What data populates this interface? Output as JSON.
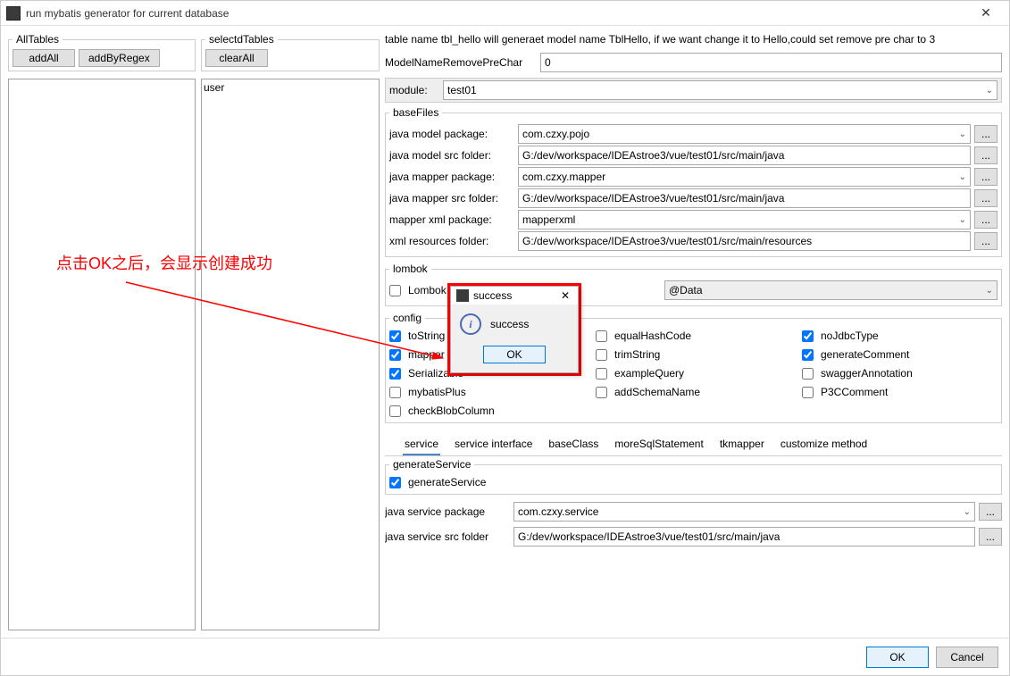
{
  "window": {
    "title": "run mybatis generator for current database"
  },
  "allTables": {
    "legend": "AllTables",
    "addAll": "addAll",
    "addByRegex": "addByRegex"
  },
  "selectedTables": {
    "legend": "selectdTables",
    "clearAll": "clearAll",
    "items": [
      "user"
    ]
  },
  "hint": "table name tbl_hello will generaet model name TblHello, if we want change it to Hello,could set remove pre char to 3",
  "modelNamePre": {
    "label": "ModelNameRemovePreChar",
    "value": "0"
  },
  "module": {
    "label": "module:",
    "value": "test01"
  },
  "baseFiles": {
    "legend": "baseFiles",
    "javaModelPackage": {
      "label": "java model package:",
      "value": "com.czxy.pojo"
    },
    "javaModelSrc": {
      "label": "java model src folder:",
      "value": "G:/dev/workspace/IDEAstroe3/vue/test01/src/main/java"
    },
    "javaMapperPackage": {
      "label": "java mapper package:",
      "value": "com.czxy.mapper"
    },
    "javaMapperSrc": {
      "label": "java mapper src folder:",
      "value": "G:/dev/workspace/IDEAstroe3/vue/test01/src/main/java"
    },
    "mapperXmlPackage": {
      "label": "mapper xml package:",
      "value": "mapperxml"
    },
    "xmlResources": {
      "label": "xml resources folder:",
      "value": "G:/dev/workspace/IDEAstroe3/vue/test01/src/main/resources"
    }
  },
  "lombok": {
    "legend": "lombok",
    "enable": "Lombok",
    "data": "@Data"
  },
  "config": {
    "legend": "config",
    "checks": {
      "toString": {
        "label": "toString",
        "checked": true
      },
      "equalHashCode": {
        "label": "equalHashCode",
        "checked": false
      },
      "noJdbcType": {
        "label": "noJdbcType",
        "checked": true
      },
      "mapper": {
        "label": "mapper",
        "checked": true
      },
      "trimString": {
        "label": "trimString",
        "checked": false
      },
      "generateComment": {
        "label": "generateComment",
        "checked": true
      },
      "serializable": {
        "label": "Serializable",
        "checked": true
      },
      "exampleQuery": {
        "label": "exampleQuery",
        "checked": false
      },
      "swaggerAnnotation": {
        "label": "swaggerAnnotation",
        "checked": false
      },
      "mybatisPlus": {
        "label": "mybatisPlus",
        "checked": false
      },
      "addSchemaName": {
        "label": "addSchemaName",
        "checked": false
      },
      "p3cComment": {
        "label": "P3CComment",
        "checked": false
      },
      "checkBlobColumn": {
        "label": "checkBlobColumn",
        "checked": false
      }
    }
  },
  "tabs": [
    "service",
    "service interface",
    "baseClass",
    "moreSqlStatement",
    "tkmapper",
    "customize method"
  ],
  "service": {
    "legend": "generateService",
    "generateService": {
      "label": "generateService",
      "checked": true
    },
    "javaServicePackage": {
      "label": "java service package",
      "value": "com.czxy.service"
    },
    "javaServiceSrc": {
      "label": "java service src folder",
      "value": "G:/dev/workspace/IDEAstroe3/vue/test01/src/main/java"
    }
  },
  "footer": {
    "ok": "OK",
    "cancel": "Cancel"
  },
  "modal": {
    "title": "success",
    "message": "success",
    "ok": "OK"
  },
  "annotation": "点击OK之后，会显示创建成功",
  "browse": "..."
}
